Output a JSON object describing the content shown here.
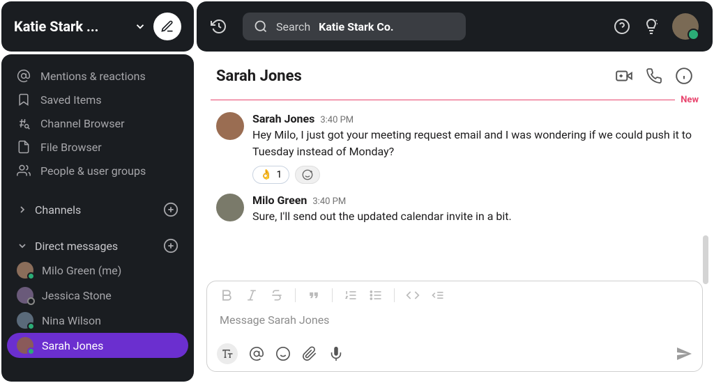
{
  "workspace": {
    "title": "Katie Stark ..."
  },
  "search": {
    "prefix": "Search",
    "query": "Katie Stark Co."
  },
  "sidebar": {
    "nav": [
      {
        "icon": "mentions",
        "label": "Mentions & reactions"
      },
      {
        "icon": "bookmark",
        "label": "Saved Items"
      },
      {
        "icon": "channel-browser",
        "label": "Channel Browser"
      },
      {
        "icon": "file-browser",
        "label": "File Browser"
      },
      {
        "icon": "people",
        "label": "People & user groups"
      }
    ],
    "channels": {
      "label": "Channels"
    },
    "dm_section": {
      "label": "Direct messages"
    },
    "dms": [
      {
        "label": "Milo Green (me)",
        "status": "online",
        "active": false
      },
      {
        "label": "Jessica Stone",
        "status": "off",
        "active": false
      },
      {
        "label": "Nina Wilson",
        "status": "online",
        "active": false
      },
      {
        "label": "Sarah Jones",
        "status": "online",
        "active": true
      }
    ]
  },
  "channel": {
    "name": "Sarah Jones",
    "divider": "New",
    "messages": [
      {
        "author": "Sarah Jones",
        "time": "3:40 PM",
        "text": "Hey Milo, I just got your meeting request email and I was wondering if we could push it to Tuesday instead of Monday?",
        "reaction_emoji": "👌",
        "reaction_count": "1"
      },
      {
        "author": "Milo Green",
        "time": "3:40 PM",
        "text": "Sure, I'll send out the updated calendar invite in a bit."
      }
    ],
    "composer_placeholder": "Message Sarah Jones"
  }
}
